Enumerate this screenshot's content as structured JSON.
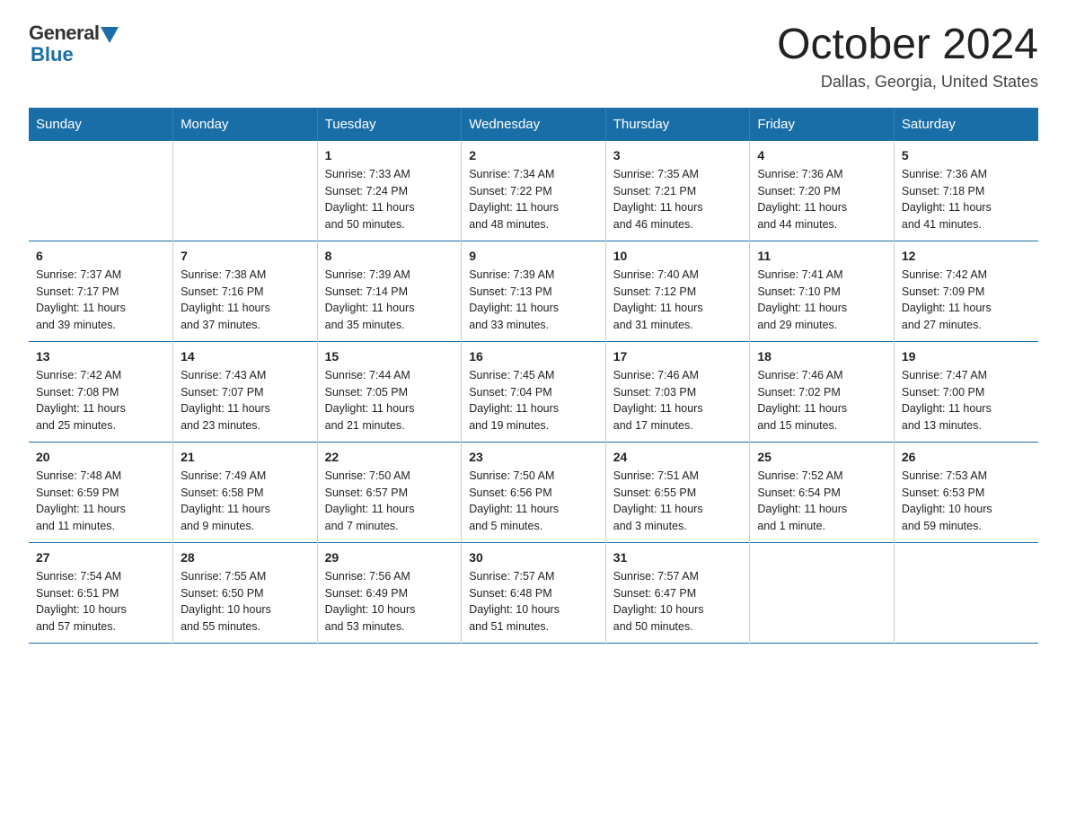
{
  "header": {
    "logo_general": "General",
    "logo_blue": "Blue",
    "month_title": "October 2024",
    "location": "Dallas, Georgia, United States"
  },
  "days_of_week": [
    "Sunday",
    "Monday",
    "Tuesday",
    "Wednesday",
    "Thursday",
    "Friday",
    "Saturday"
  ],
  "weeks": [
    [
      {
        "day": "",
        "info": ""
      },
      {
        "day": "",
        "info": ""
      },
      {
        "day": "1",
        "info": "Sunrise: 7:33 AM\nSunset: 7:24 PM\nDaylight: 11 hours\nand 50 minutes."
      },
      {
        "day": "2",
        "info": "Sunrise: 7:34 AM\nSunset: 7:22 PM\nDaylight: 11 hours\nand 48 minutes."
      },
      {
        "day": "3",
        "info": "Sunrise: 7:35 AM\nSunset: 7:21 PM\nDaylight: 11 hours\nand 46 minutes."
      },
      {
        "day": "4",
        "info": "Sunrise: 7:36 AM\nSunset: 7:20 PM\nDaylight: 11 hours\nand 44 minutes."
      },
      {
        "day": "5",
        "info": "Sunrise: 7:36 AM\nSunset: 7:18 PM\nDaylight: 11 hours\nand 41 minutes."
      }
    ],
    [
      {
        "day": "6",
        "info": "Sunrise: 7:37 AM\nSunset: 7:17 PM\nDaylight: 11 hours\nand 39 minutes."
      },
      {
        "day": "7",
        "info": "Sunrise: 7:38 AM\nSunset: 7:16 PM\nDaylight: 11 hours\nand 37 minutes."
      },
      {
        "day": "8",
        "info": "Sunrise: 7:39 AM\nSunset: 7:14 PM\nDaylight: 11 hours\nand 35 minutes."
      },
      {
        "day": "9",
        "info": "Sunrise: 7:39 AM\nSunset: 7:13 PM\nDaylight: 11 hours\nand 33 minutes."
      },
      {
        "day": "10",
        "info": "Sunrise: 7:40 AM\nSunset: 7:12 PM\nDaylight: 11 hours\nand 31 minutes."
      },
      {
        "day": "11",
        "info": "Sunrise: 7:41 AM\nSunset: 7:10 PM\nDaylight: 11 hours\nand 29 minutes."
      },
      {
        "day": "12",
        "info": "Sunrise: 7:42 AM\nSunset: 7:09 PM\nDaylight: 11 hours\nand 27 minutes."
      }
    ],
    [
      {
        "day": "13",
        "info": "Sunrise: 7:42 AM\nSunset: 7:08 PM\nDaylight: 11 hours\nand 25 minutes."
      },
      {
        "day": "14",
        "info": "Sunrise: 7:43 AM\nSunset: 7:07 PM\nDaylight: 11 hours\nand 23 minutes."
      },
      {
        "day": "15",
        "info": "Sunrise: 7:44 AM\nSunset: 7:05 PM\nDaylight: 11 hours\nand 21 minutes."
      },
      {
        "day": "16",
        "info": "Sunrise: 7:45 AM\nSunset: 7:04 PM\nDaylight: 11 hours\nand 19 minutes."
      },
      {
        "day": "17",
        "info": "Sunrise: 7:46 AM\nSunset: 7:03 PM\nDaylight: 11 hours\nand 17 minutes."
      },
      {
        "day": "18",
        "info": "Sunrise: 7:46 AM\nSunset: 7:02 PM\nDaylight: 11 hours\nand 15 minutes."
      },
      {
        "day": "19",
        "info": "Sunrise: 7:47 AM\nSunset: 7:00 PM\nDaylight: 11 hours\nand 13 minutes."
      }
    ],
    [
      {
        "day": "20",
        "info": "Sunrise: 7:48 AM\nSunset: 6:59 PM\nDaylight: 11 hours\nand 11 minutes."
      },
      {
        "day": "21",
        "info": "Sunrise: 7:49 AM\nSunset: 6:58 PM\nDaylight: 11 hours\nand 9 minutes."
      },
      {
        "day": "22",
        "info": "Sunrise: 7:50 AM\nSunset: 6:57 PM\nDaylight: 11 hours\nand 7 minutes."
      },
      {
        "day": "23",
        "info": "Sunrise: 7:50 AM\nSunset: 6:56 PM\nDaylight: 11 hours\nand 5 minutes."
      },
      {
        "day": "24",
        "info": "Sunrise: 7:51 AM\nSunset: 6:55 PM\nDaylight: 11 hours\nand 3 minutes."
      },
      {
        "day": "25",
        "info": "Sunrise: 7:52 AM\nSunset: 6:54 PM\nDaylight: 11 hours\nand 1 minute."
      },
      {
        "day": "26",
        "info": "Sunrise: 7:53 AM\nSunset: 6:53 PM\nDaylight: 10 hours\nand 59 minutes."
      }
    ],
    [
      {
        "day": "27",
        "info": "Sunrise: 7:54 AM\nSunset: 6:51 PM\nDaylight: 10 hours\nand 57 minutes."
      },
      {
        "day": "28",
        "info": "Sunrise: 7:55 AM\nSunset: 6:50 PM\nDaylight: 10 hours\nand 55 minutes."
      },
      {
        "day": "29",
        "info": "Sunrise: 7:56 AM\nSunset: 6:49 PM\nDaylight: 10 hours\nand 53 minutes."
      },
      {
        "day": "30",
        "info": "Sunrise: 7:57 AM\nSunset: 6:48 PM\nDaylight: 10 hours\nand 51 minutes."
      },
      {
        "day": "31",
        "info": "Sunrise: 7:57 AM\nSunset: 6:47 PM\nDaylight: 10 hours\nand 50 minutes."
      },
      {
        "day": "",
        "info": ""
      },
      {
        "day": "",
        "info": ""
      }
    ]
  ]
}
